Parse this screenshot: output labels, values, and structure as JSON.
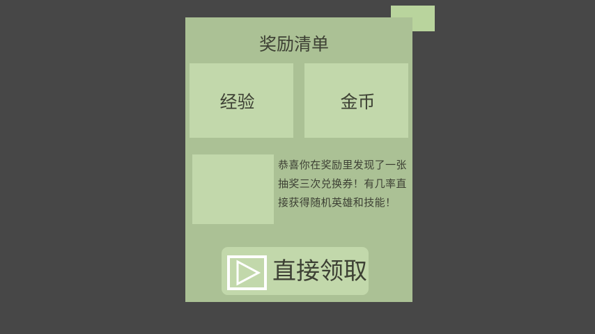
{
  "dialog": {
    "title": "奖励清单",
    "rewards": [
      {
        "label": "经验"
      },
      {
        "label": "金币"
      }
    ],
    "description": "恭喜你在奖励里发现了一张抽奖三次兑换券！有几率直接获得随机英雄和技能！",
    "claim_button": {
      "icon": "play-icon",
      "label": "直接领取"
    },
    "close_tab": {
      "icon": "close-icon"
    }
  },
  "colors": {
    "background": "#474747",
    "panel": "#abc195",
    "card": "#c2d8ab",
    "close_tab": "#b9d49d",
    "text": "#3d4034",
    "icon_stroke": "#ffffff"
  }
}
